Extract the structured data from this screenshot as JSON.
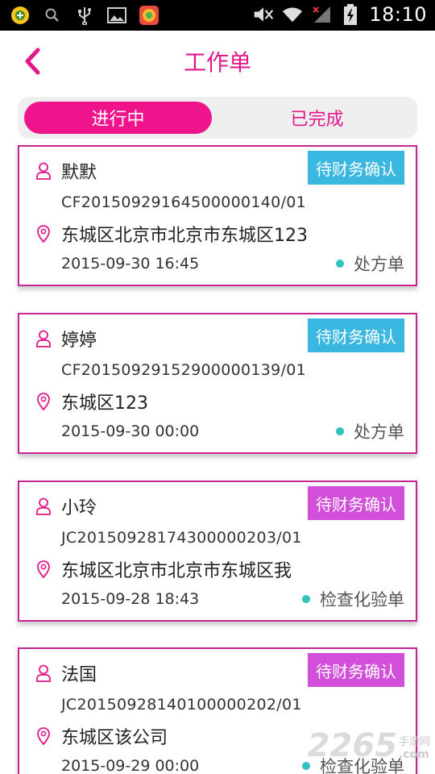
{
  "status_bar": {
    "time": "18:10",
    "icons": [
      "app-badge-icon",
      "search-icon",
      "usb-icon",
      "image-icon",
      "app-store-icon",
      "mute-icon",
      "wifi-icon",
      "signal-icon",
      "battery-charging-icon"
    ]
  },
  "header": {
    "title": "工作单",
    "accent_color": "#e3178c"
  },
  "tabs": [
    {
      "label": "进行中",
      "active": true
    },
    {
      "label": "已完成",
      "active": false
    }
  ],
  "orders": [
    {
      "name": "默默",
      "code": "CF2015092916450000 0140/01",
      "address": "东城区北京市北京市东城区123",
      "datetime": "2015-09-30 16:45",
      "status": "待财务确认",
      "status_color": "#3ab7e0",
      "type": "处方单"
    },
    {
      "name": "婷婷",
      "code": "CF2015092915290000 0139/01",
      "address": "东城区123",
      "datetime": "2015-09-30 00:00",
      "status": "待财务确认",
      "status_color": "#3ab7e0",
      "type": "处方单"
    },
    {
      "name": "小玲",
      "code": "JC2015092817430000 0203/01",
      "address": "东城区北京市北京市东城区我",
      "datetime": "2015-09-28 18:43",
      "status": "待财务确认",
      "status_color": "#d14fd9",
      "type": "检查化验单"
    },
    {
      "name": "法国",
      "code": "JC2015092814010000 0202/01",
      "address": "东城区该公司",
      "datetime": "2015-09-29 00:00",
      "status": "待财务确认",
      "status_color": "#d14fd9",
      "type": "检查化验单"
    }
  ],
  "watermark": {
    "number": "2265",
    "site_cn": "手游网",
    "domain": ".com"
  }
}
